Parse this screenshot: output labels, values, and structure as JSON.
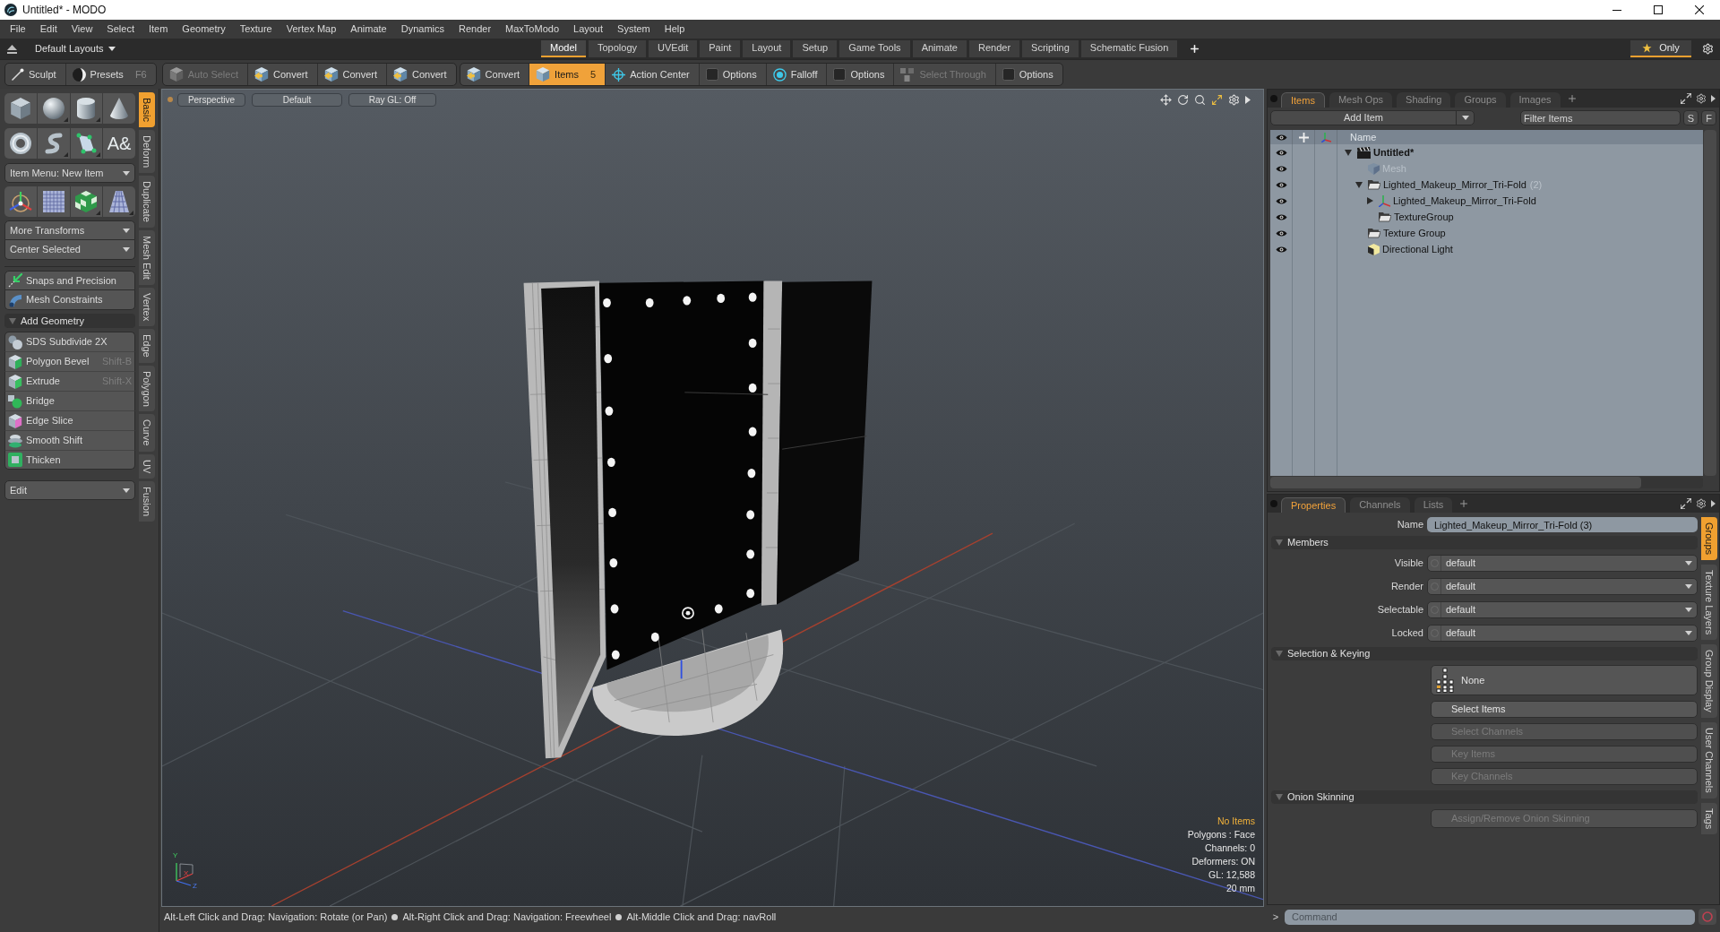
{
  "window": {
    "title": "Untitled* - MODO"
  },
  "menu_bar": [
    "File",
    "Edit",
    "View",
    "Select",
    "Item",
    "Geometry",
    "Texture",
    "Vertex Map",
    "Animate",
    "Dynamics",
    "Render",
    "MaxToModo",
    "Layout",
    "System",
    "Help"
  ],
  "layout_bar": {
    "layouts_label": "Default Layouts",
    "tabs": [
      {
        "label": "Model",
        "selected": true
      },
      {
        "label": "Topology",
        "selected": false
      },
      {
        "label": "UVEdit",
        "selected": false
      },
      {
        "label": "Paint",
        "selected": false
      },
      {
        "label": "Layout",
        "selected": false
      },
      {
        "label": "Setup",
        "selected": false
      },
      {
        "label": "Game Tools",
        "selected": false
      },
      {
        "label": "Animate",
        "selected": false
      },
      {
        "label": "Render",
        "selected": false
      },
      {
        "label": "Scripting",
        "selected": false
      },
      {
        "label": "Schematic Fusion",
        "selected": false
      }
    ],
    "only_filter": {
      "label": "Only",
      "on": true
    }
  },
  "toolbar": {
    "groups": [
      [
        {
          "kind": "sculpt",
          "label": "Sculpt",
          "selected": false,
          "disabled": false
        },
        {
          "kind": "presets",
          "label": "Presets",
          "shortcut": "F6",
          "selected": false,
          "disabled": false
        }
      ],
      [
        {
          "kind": "auto-select",
          "label": "Auto Select",
          "selected": false,
          "disabled": true
        },
        {
          "kind": "convert",
          "label": "Convert",
          "selected": false,
          "disabled": false
        },
        {
          "kind": "convert",
          "label": "Convert",
          "selected": false,
          "disabled": false
        },
        {
          "kind": "convert",
          "label": "Convert",
          "selected": false,
          "disabled": false
        }
      ],
      [
        {
          "kind": "convert",
          "label": "Convert",
          "selected": false,
          "disabled": false
        },
        {
          "kind": "items",
          "label": "Items",
          "shortcut": "5",
          "selected": true,
          "disabled": false
        },
        {
          "kind": "action-center",
          "label": "Action Center",
          "selected": false,
          "disabled": false
        },
        {
          "kind": "options",
          "label": "Options",
          "checked": false,
          "selected": false,
          "disabled": false
        },
        {
          "kind": "falloff",
          "label": "Falloff",
          "selected": false,
          "disabled": false
        },
        {
          "kind": "options",
          "label": "Options",
          "checked": false,
          "selected": false,
          "disabled": false
        },
        {
          "kind": "select-through",
          "label": "Select Through",
          "selected": false,
          "disabled": true
        },
        {
          "kind": "options",
          "label": "Options",
          "checked": false,
          "selected": false,
          "disabled": false
        }
      ]
    ]
  },
  "tool_panel": {
    "icon_rows": [
      [
        {
          "kind": "cube",
          "submenu": false
        },
        {
          "kind": "sphere",
          "submenu": true
        },
        {
          "kind": "cylinder",
          "submenu": true
        },
        {
          "kind": "cone",
          "submenu": false
        }
      ],
      [
        {
          "kind": "torus",
          "submenu": false
        },
        {
          "kind": "capsule",
          "submenu": true
        },
        {
          "kind": "pen",
          "submenu": true
        },
        {
          "kind": "text",
          "glyph": "A&",
          "submenu": false
        }
      ]
    ],
    "item_menu": "Item Menu: New Item",
    "transform_row": [
      {
        "kind": "gizmo",
        "submenu": false
      },
      {
        "kind": "grid",
        "submenu": false
      },
      {
        "kind": "checker",
        "submenu": true
      },
      {
        "kind": "pyramid",
        "submenu": true
      }
    ],
    "transform_menus": [
      "More Transforms",
      "Center Selected"
    ],
    "constraint_tools": [
      "Snaps and Precision",
      "Mesh Constraints"
    ],
    "add_geometry": {
      "title": "Add Geometry",
      "expanded": true,
      "tools": [
        {
          "label": "SDS Subdivide 2X"
        },
        {
          "label": "Polygon Bevel",
          "shortcut": "Shift-B"
        },
        {
          "label": "Extrude",
          "shortcut": "Shift-X"
        },
        {
          "label": "Bridge"
        },
        {
          "label": "Edge Slice"
        },
        {
          "label": "Smooth Shift"
        },
        {
          "label": "Thicken"
        }
      ]
    },
    "edit_menu": "Edit"
  },
  "tool_tabs": [
    {
      "label": "Basic",
      "selected": true
    },
    {
      "label": "Deform",
      "selected": false
    },
    {
      "label": "Duplicate",
      "selected": false
    },
    {
      "label": "Mesh Edit",
      "selected": false
    },
    {
      "label": "Vertex",
      "selected": false
    },
    {
      "label": "Edge",
      "selected": false
    },
    {
      "label": "Polygon",
      "selected": false
    },
    {
      "label": "Curve",
      "selected": false
    },
    {
      "label": "UV",
      "selected": false
    },
    {
      "label": "Fusion",
      "selected": false
    }
  ],
  "viewport": {
    "view_buttons": [
      "Perspective",
      "Default",
      "Ray GL: Off"
    ],
    "axis_labels": [
      "Y",
      "X",
      "Z"
    ],
    "stats": {
      "selection": "No Items",
      "lines": [
        "Polygons : Face",
        "Channels: 0",
        "Deformers: ON",
        "GL: 12,588",
        "20 mm"
      ]
    }
  },
  "status_bar": {
    "hints": [
      "Alt-Left Click and Drag: Navigation: Rotate (or Pan)",
      "Alt-Right Click and Drag: Navigation: Freewheel",
      "Alt-Middle Click and Drag: navRoll"
    ]
  },
  "items_panel": {
    "tabs": [
      {
        "label": "Items",
        "selected": true
      },
      {
        "label": "Mesh Ops",
        "selected": false
      },
      {
        "label": "Shading",
        "selected": false
      },
      {
        "label": "Groups",
        "selected": false
      },
      {
        "label": "Images",
        "selected": false
      }
    ],
    "add_item": "Add Item",
    "filter": {
      "placeholder": "Filter Items"
    },
    "toggles": [
      "S",
      "F"
    ],
    "name_column": "Name",
    "tree": [
      {
        "kind": "scene",
        "name": "Untitled*",
        "expanded": true,
        "visible": true,
        "dimmed": false,
        "children": [
          {
            "kind": "mesh",
            "name": "Mesh",
            "visible": true,
            "dimmed": true
          },
          {
            "kind": "group",
            "name": "Lighted_Makeup_Mirror_Tri-Fold",
            "count": "(2)",
            "expanded": true,
            "visible": true,
            "dimmed": false,
            "children": [
              {
                "kind": "locator",
                "name": "Lighted_Makeup_Mirror_Tri-Fold",
                "expanded": false,
                "visible": true,
                "dimmed": false
              },
              {
                "kind": "group",
                "name": "TextureGroup",
                "visible": true,
                "dimmed": false
              }
            ]
          },
          {
            "kind": "group",
            "name": "Texture Group",
            "visible": true,
            "dimmed": false
          },
          {
            "kind": "light",
            "name": "Directional Light",
            "visible": true,
            "dimmed": false
          }
        ]
      }
    ]
  },
  "properties_panel": {
    "tabs": [
      {
        "label": "Properties",
        "selected": true
      },
      {
        "label": "Channels",
        "selected": false
      },
      {
        "label": "Lists",
        "selected": false
      }
    ],
    "name_field": {
      "label": "Name",
      "value": "Lighted_Makeup_Mirror_Tri-Fold (3)"
    },
    "sections": [
      {
        "kind": "dropdowns",
        "title": "Members",
        "expanded": true,
        "fields": [
          {
            "label": "Visible",
            "value": "default"
          },
          {
            "label": "Render",
            "value": "default"
          },
          {
            "label": "Selectable",
            "value": "default"
          },
          {
            "label": "Locked",
            "value": "default"
          }
        ]
      },
      {
        "kind": "buttons",
        "title": "Selection & Keying",
        "expanded": true,
        "preset": "None",
        "buttons": [
          {
            "label": "Select Items",
            "disabled": false
          },
          {
            "label": "Select Channels",
            "disabled": true
          },
          {
            "label": "Key Items",
            "disabled": true
          },
          {
            "label": "Key Channels",
            "disabled": true
          }
        ]
      },
      {
        "kind": "buttons",
        "title": "Onion Skinning",
        "expanded": true,
        "buttons": [
          {
            "label": "Assign/Remove Onion Skinning",
            "disabled": true
          }
        ]
      }
    ],
    "side_tabs": [
      {
        "label": "Groups",
        "selected": true
      },
      {
        "label": "Texture Layers",
        "selected": false
      },
      {
        "label": "Group Display",
        "selected": false
      },
      {
        "label": "User Channels",
        "selected": false
      },
      {
        "label": "Tags",
        "selected": false
      }
    ]
  },
  "command_bar": {
    "prompt": ">",
    "placeholder": "Command"
  }
}
